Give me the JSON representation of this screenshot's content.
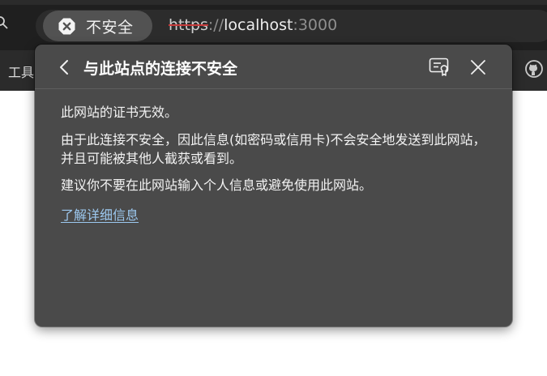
{
  "browser": {
    "security_label": "不安全",
    "url": {
      "scheme": "https",
      "separator": "://",
      "host": "localhost",
      "port": ":3000"
    },
    "bookmarks": {
      "tools_label": "工具"
    }
  },
  "popup": {
    "title": "与此站点的连接不安全",
    "paragraph1": "此网站的证书无效。",
    "paragraph2": "由于此连接不安全，因此信息(如密码或信用卡)不会安全地发送到此网站，并且可能被其他人截获或看到。",
    "paragraph3": "建议你不要在此网站输入个人信息或避免使用此网站。",
    "learn_more": "了解详细信息"
  },
  "colors": {
    "popup_bg": "#4a4a4a",
    "link": "#9cc8ef",
    "insecure_strike": "#c83b3b"
  },
  "icons": {
    "back": "chevron-left-icon",
    "certificate": "certificate-icon",
    "close": "close-icon",
    "warning": "not-secure-icon",
    "github": "github-icon",
    "search": "search-icon"
  }
}
